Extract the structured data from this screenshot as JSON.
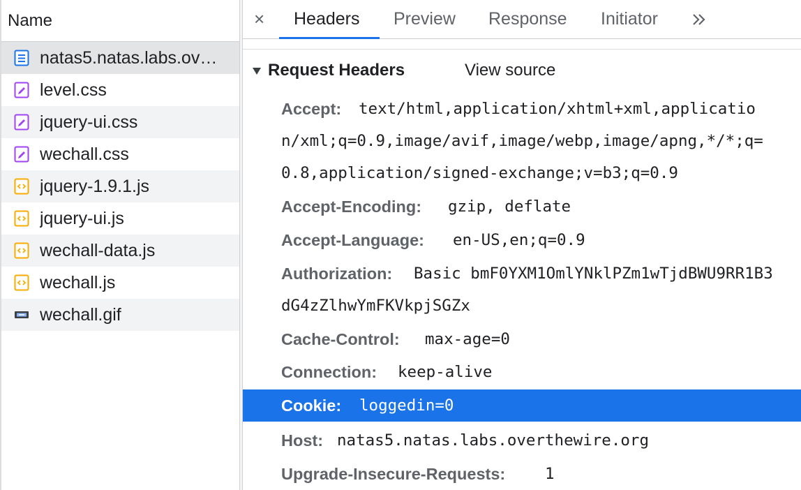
{
  "file_list": {
    "header": "Name",
    "items": [
      {
        "label": "natas5.natas.labs.ov…",
        "icon": "document-icon"
      },
      {
        "label": "level.css",
        "icon": "stylesheet-icon"
      },
      {
        "label": "jquery-ui.css",
        "icon": "stylesheet-icon"
      },
      {
        "label": "wechall.css",
        "icon": "stylesheet-icon"
      },
      {
        "label": "jquery-1.9.1.js",
        "icon": "script-icon"
      },
      {
        "label": "jquery-ui.js",
        "icon": "script-icon"
      },
      {
        "label": "wechall-data.js",
        "icon": "script-icon"
      },
      {
        "label": "wechall.js",
        "icon": "script-icon"
      },
      {
        "label": "wechall.gif",
        "icon": "image-icon"
      }
    ]
  },
  "tabs": {
    "close_glyph": "×",
    "items": [
      "Headers",
      "Preview",
      "Response",
      "Initiator"
    ],
    "active": "Headers",
    "overflow_glyph": "»"
  },
  "request_headers": {
    "title": "Request Headers",
    "view_source": "View source",
    "rows": [
      {
        "name": "Accept:",
        "lines": [
          "text/html,application/xhtml+xml,applicatio",
          "n/xml;q=0.9,image/avif,image/webp,image/apng,*/*;q=",
          "0.8,application/signed-exchange;v=b3;q=0.9"
        ]
      },
      {
        "name": "Accept-Encoding:",
        "lines": [
          "gzip, deflate"
        ]
      },
      {
        "name": "Accept-Language:",
        "lines": [
          "en-US,en;q=0.9"
        ]
      },
      {
        "name": "Authorization:",
        "lines": [
          "Basic bmF0YXM1OmlYNklPZm1wTjdBWU9RR1B3",
          "dG4zZlhwYmFKVkpjSGZx"
        ]
      },
      {
        "name": "Cache-Control:",
        "lines": [
          "max-age=0"
        ]
      },
      {
        "name": "Connection:",
        "lines": [
          "keep-alive"
        ]
      },
      {
        "name": "Cookie:",
        "lines": [
          "loggedin=0"
        ],
        "selected": true
      },
      {
        "name": "Host:",
        "lines": [
          "natas5.natas.labs.overthewire.org"
        ]
      },
      {
        "name": "Upgrade-Insecure-Requests:",
        "lines": [
          "1"
        ]
      }
    ]
  },
  "colors": {
    "accent": "#1a73e8",
    "document_icon": "#1a73e8",
    "stylesheet_icon": "#a142f4",
    "script_icon": "#f9ab00"
  }
}
